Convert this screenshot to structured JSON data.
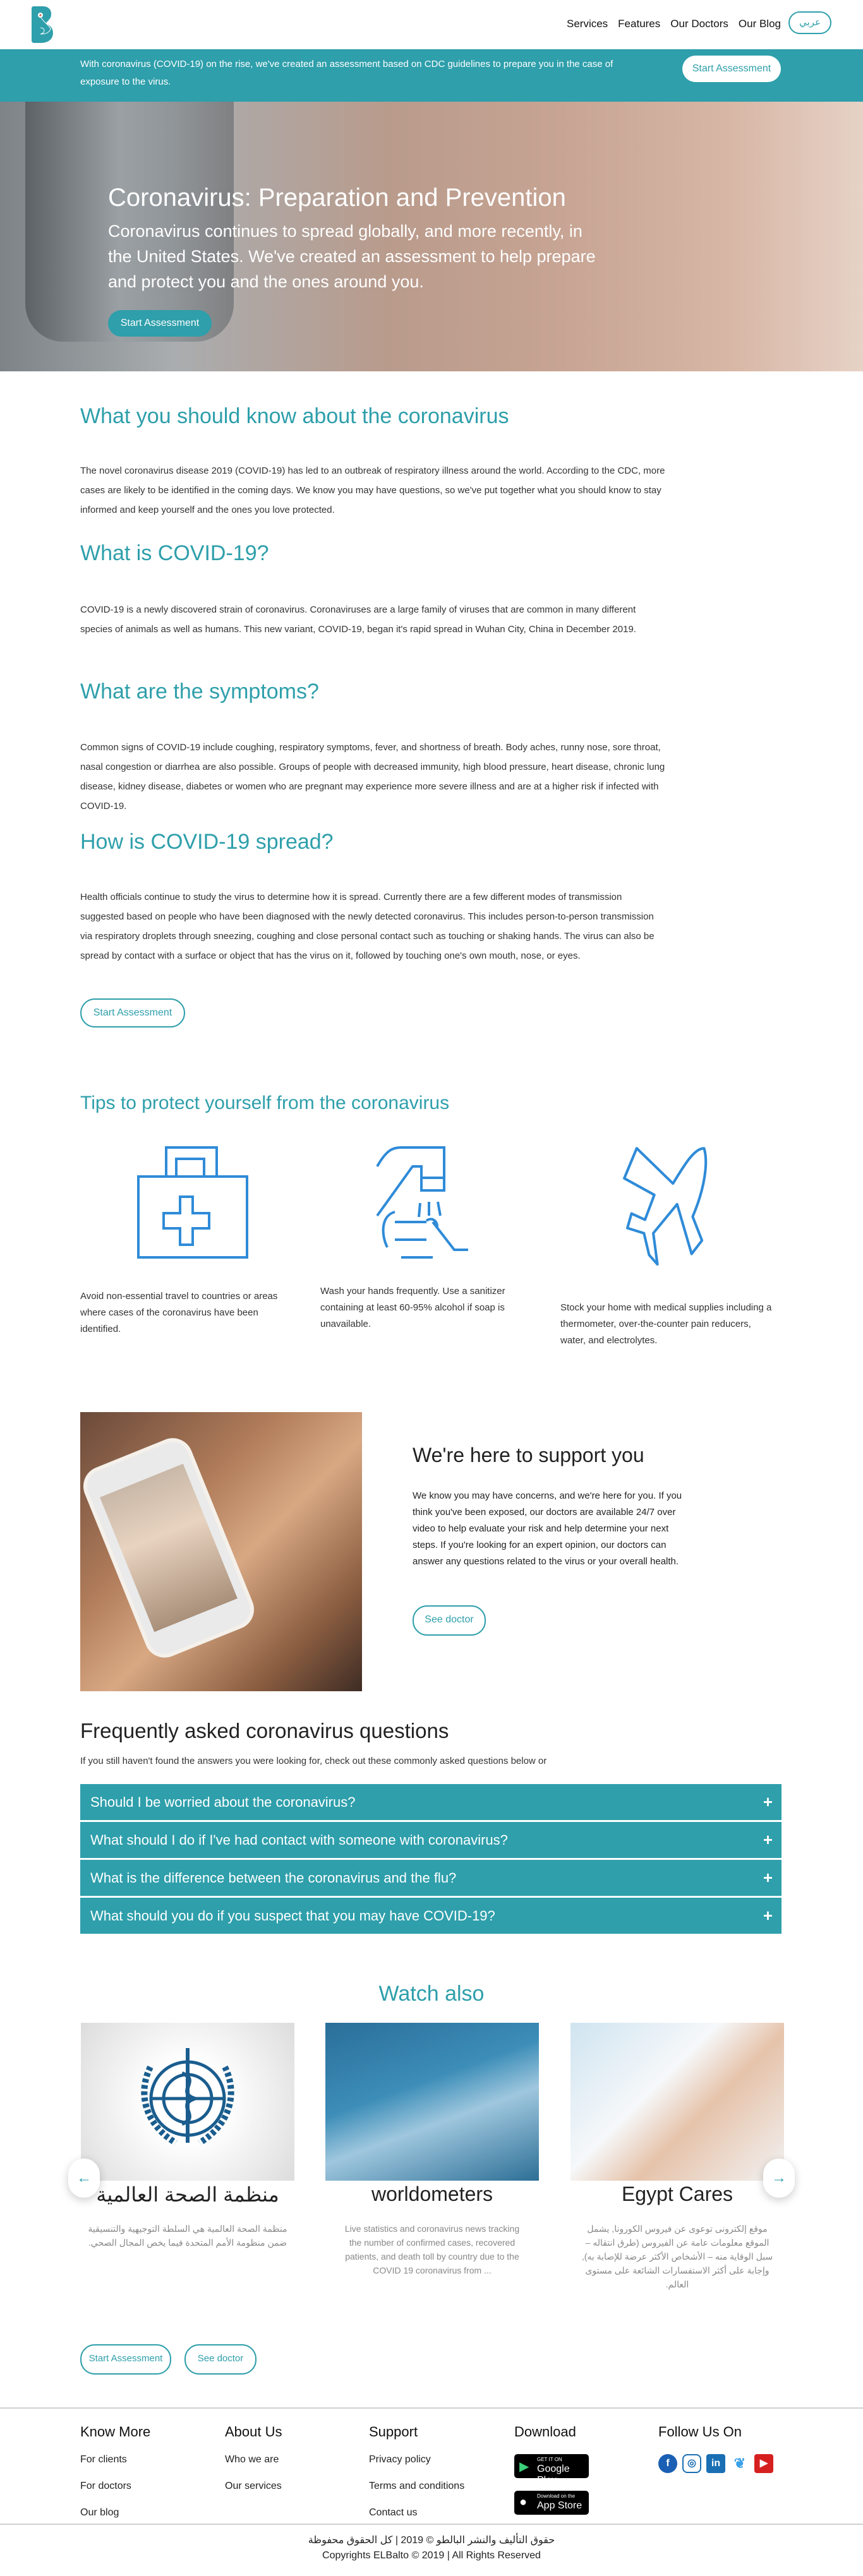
{
  "nav": {
    "links": [
      "Services",
      "Features",
      "Our Doctors",
      "Our Blog"
    ],
    "lang_button": "عربي"
  },
  "banner": {
    "text": "With coronavirus (COVID-19) on the rise, we've created an assessment based on CDC guidelines to prepare you in the case of exposure to the virus.",
    "button": "Start Assessment"
  },
  "hero": {
    "title": "Coronavirus: Preparation and Prevention",
    "text": "Coronavirus continues to spread globally, and more recently, in the United States. We've created an assessment to help prepare and protect you and the ones around you.",
    "button": "Start Assessment"
  },
  "sections": [
    {
      "title": "What you should know about the coronavirus",
      "text": "The novel coronavirus disease 2019 (COVID-19) has led to an outbreak of respiratory illness around the world. According to the CDC, more cases are likely to be identified in the coming days. We know you may have questions, so we've put together what you should know to stay informed and keep yourself and the ones you love protected."
    },
    {
      "title": "What is COVID-19?",
      "text": "COVID-19 is a newly discovered strain of coronavirus. Coronaviruses are a large family of viruses that are common in many different species of animals as well as humans. This new variant, COVID-19, began it's rapid spread in Wuhan City, China in December 2019."
    },
    {
      "title": "What are the symptoms?",
      "text": "Common signs of COVID-19 include coughing, respiratory symptoms, fever, and shortness of breath. Body aches, runny nose, sore throat, nasal congestion or diarrhea are also possible. Groups of people with decreased immunity, high blood pressure, heart disease, chronic lung disease, kidney disease, diabetes or women who are pregnant may experience more severe illness and are at a higher risk if infected with COVID-19."
    },
    {
      "title": "How is COVID-19 spread?",
      "text": "Health officials continue to study the virus to determine how it is spread. Currently there are a few different modes of transmission suggested based on people who have been diagnosed with the newly detected coronavirus. This includes person-to-person transmission via respiratory droplets through sneezing, coughing and close personal contact such as touching or shaking hands. The virus can also be spread by contact with a surface or object that has the virus on it, followed by touching one's own mouth, nose, or eyes."
    }
  ],
  "sections_button": "Start Assessment",
  "tips": {
    "title": "Tips to protect yourself from the coronavirus",
    "items": [
      {
        "icon": "first-aid-kit-icon",
        "text": "Avoid non-essential travel to countries or areas where cases of the coronavirus have been identified."
      },
      {
        "icon": "hand-sanitizer-icon",
        "text": "Wash your hands frequently. Use a sanitizer containing at least 60-95% alcohol if soap is unavailable."
      },
      {
        "icon": "airplane-icon",
        "text": "Stock your home with medical supplies including a thermometer, over-the-counter pain reducers, water, and electrolytes."
      }
    ]
  },
  "support": {
    "title": "We're here to support you",
    "text": "We know you may have concerns, and we're here for you. If you think you've been exposed, our doctors are available 24/7 over video to help evaluate your risk and help determine your next steps. If you're looking for an expert opinion, our doctors can answer any questions related to the virus or your overall health.",
    "button": "See doctor"
  },
  "faq": {
    "title": "Frequently asked coronavirus questions",
    "subtitle": "If you still haven't found the answers you were looking for, check out these commonly asked questions below or",
    "items": [
      "Should I be worried about the coronavirus?",
      "What should I do if I've had contact with someone with coronavirus?",
      "What is the difference between the coronavirus and the flu?",
      "What should you do if you suspect that you may have COVID-19?"
    ]
  },
  "watch": {
    "title": "Watch also",
    "cards": [
      {
        "title": "منظمة الصحة العالمية",
        "desc": "منظمة الصحة العالمية هي السلطة التوجيهية والتنسيقية ضمن منظومة الأمم المتحدة فيما يخص المجال الصحي."
      },
      {
        "title": "worldometers",
        "desc": "Live statistics and coronavirus news tracking the number of confirmed cases, recovered patients, and death toll by country due to the COVID 19 coronavirus from ..."
      },
      {
        "title": "Egypt Cares",
        "desc": "موقع إلكترونى توعوى عن فيروس الكورونا, يشمل الموقع معلومات عامة عن الفيروس (طرق انتقاله – سبل الوقاية منه – الأشخاص الأكثر عرضة للإصابة به), وإجابة على أكثر الاستفسارات الشائعة على مستوى العالم."
      }
    ],
    "buttons": [
      "Start Assessment",
      "See doctor"
    ]
  },
  "footer": {
    "columns": [
      {
        "title": "Know More",
        "links": [
          "For clients",
          "For doctors",
          "Our blog"
        ]
      },
      {
        "title": "About Us",
        "links": [
          "Who we are",
          "Our services"
        ]
      },
      {
        "title": "Support",
        "links": [
          "Privacy policy",
          "Terms and conditions",
          "Contact us"
        ]
      }
    ],
    "download": {
      "title": "Download",
      "google_small": "GET IT ON",
      "google": "Google Play",
      "apple_small": "Download on the",
      "apple": "App Store"
    },
    "follow": {
      "title": "Follow Us On",
      "icons": [
        "facebook-icon",
        "instagram-icon",
        "linkedin-icon",
        "twitter-icon",
        "youtube-icon"
      ]
    },
    "copyright_ar": "حقوق التأليف والنشر البالطو © 2019 | كل الحقوق محفوظة",
    "copyright_en": "Copyrights ELBalto © 2019 | All Rights Reserved"
  },
  "colors": {
    "accent": "#2e9fab",
    "icon_blue": "#2f8bd8"
  }
}
